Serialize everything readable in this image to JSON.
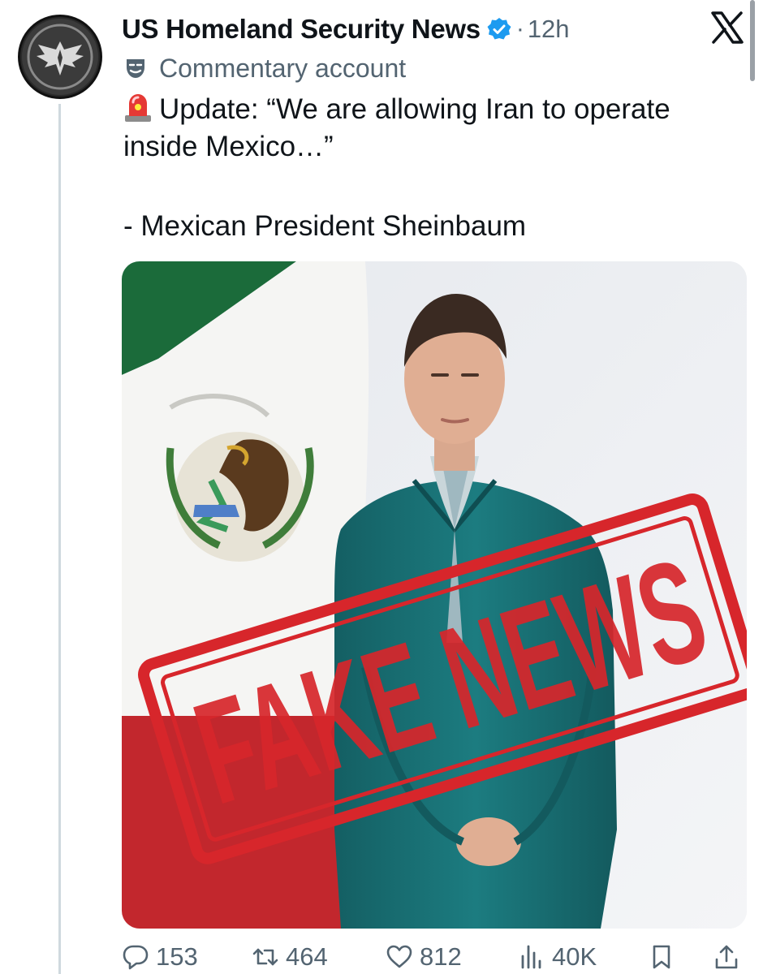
{
  "author": {
    "display_name": "US Homeland Security News",
    "separator": "·",
    "time": "12h",
    "label": "Commentary account"
  },
  "post": {
    "text": "Update: “We are allowing Iran to operate inside Mexico…”",
    "attribution": "- Mexican President Sheinbaum"
  },
  "media": {
    "stamp_text": "FAKE NEWS",
    "stamp_color": "#d7262b"
  },
  "metrics": {
    "replies": "153",
    "reposts": "464",
    "likes": "812",
    "views": "40K"
  },
  "colors": {
    "verified": "#1d9bf0",
    "secondary_text": "#536471",
    "flag_green": "#1b6b3a",
    "flag_red": "#c2272d",
    "suit": "#1c7c80"
  },
  "icons": {
    "reply": "speech-bubble-icon",
    "repost": "repost-arrows-icon",
    "like": "heart-icon",
    "views": "bar-chart-icon",
    "bookmark": "bookmark-icon",
    "share": "share-icon"
  }
}
